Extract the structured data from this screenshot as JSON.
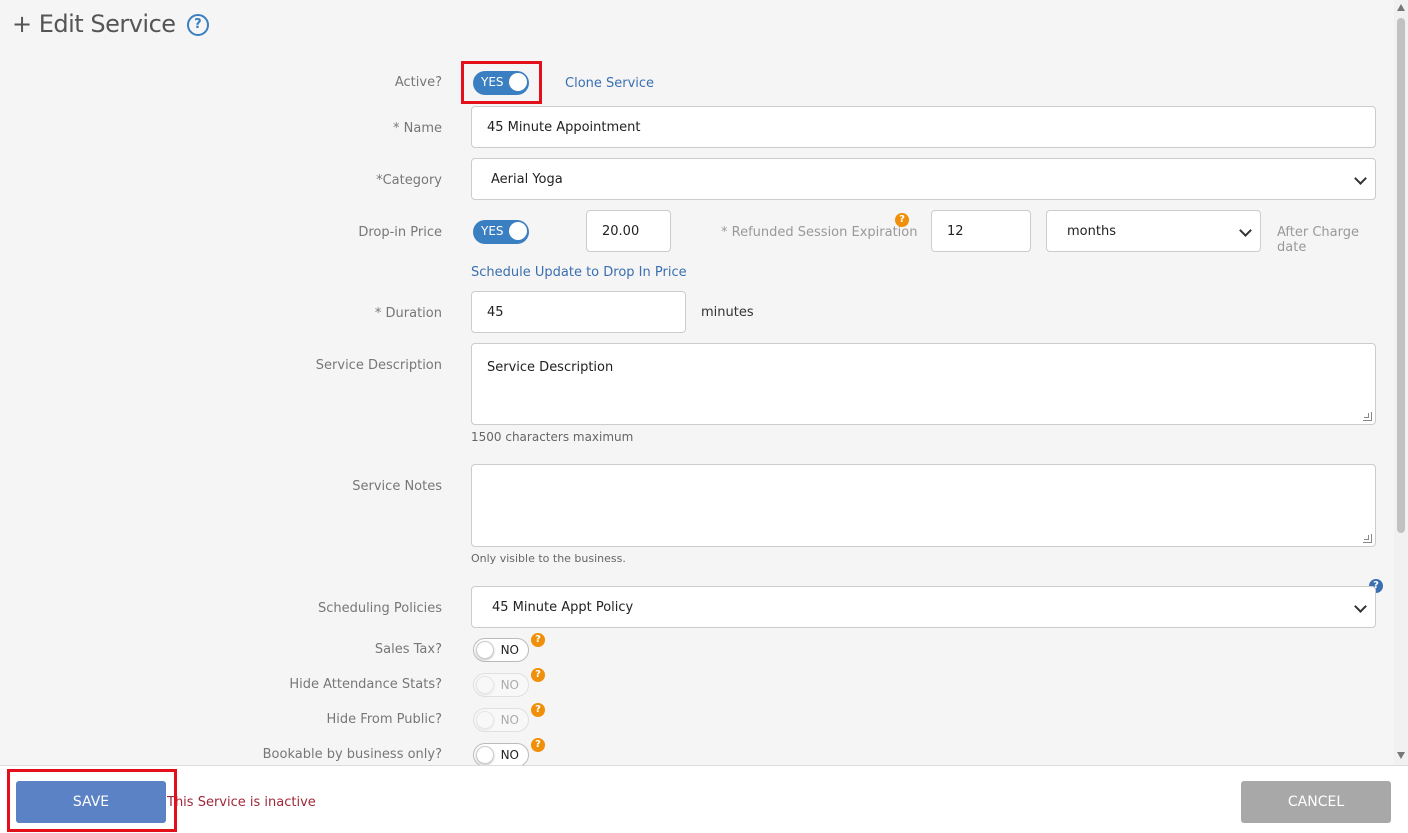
{
  "header": {
    "title": "+ Edit Service",
    "help_icon": "?"
  },
  "form": {
    "active": {
      "label": "Active?",
      "toggle": "YES",
      "state": "on"
    },
    "clone_link": "Clone Service",
    "name": {
      "label": "* Name",
      "value": "45 Minute Appointment"
    },
    "category": {
      "label": "*Category",
      "value": "Aerial Yoga"
    },
    "drop_in": {
      "label": "Drop-in Price",
      "toggle": "YES",
      "price": "20.00",
      "refund_label": "* Refunded Session Expiration",
      "refund_value": "12",
      "refund_unit": "months",
      "after_charge": "After Charge date",
      "schedule_link": "Schedule Update to Drop In Price"
    },
    "duration": {
      "label": "* Duration",
      "value": "45",
      "unit": "minutes"
    },
    "description": {
      "label": "Service Description",
      "value": "Service Description",
      "hint": "1500 characters maximum"
    },
    "notes": {
      "label": "Service Notes",
      "value": "",
      "hint": "Only visible to the business."
    },
    "policy": {
      "label": "Scheduling Policies",
      "value": "45 Minute Appt Policy"
    },
    "sales_tax": {
      "label": "Sales Tax?",
      "toggle": "NO"
    },
    "hide_attendance": {
      "label": "Hide Attendance Stats?",
      "toggle": "NO"
    },
    "hide_public": {
      "label": "Hide From Public?",
      "toggle": "NO"
    },
    "bookable": {
      "label": "Bookable by business only?",
      "toggle": "NO"
    },
    "info_icon": "?"
  },
  "footer": {
    "save": "SAVE",
    "inactive_msg": "This Service is inactive",
    "cancel": "CANCEL"
  },
  "colors": {
    "primary": "#3a7fc1",
    "save_button": "#5b82c4",
    "cancel_button": "#a8a8a8",
    "warning": "#f0900a",
    "error_text": "#a0283a",
    "highlight": "#e3101b"
  }
}
